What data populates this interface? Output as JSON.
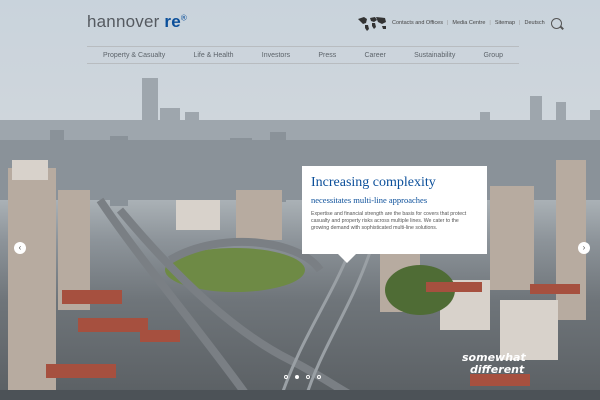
{
  "header": {
    "logo_main": "hannover ",
    "logo_accent": "re",
    "logo_mark": "®",
    "utility_links": [
      "Contacts and Offices",
      "Media Centre",
      "Sitemap",
      "Deutsch"
    ],
    "utility_separator": "|",
    "search_icon": "search-icon",
    "globe_icon": "world-map-icon"
  },
  "nav": {
    "items": [
      "Property & Casualty",
      "Life & Health",
      "Investors",
      "Press",
      "Career",
      "Sustainability",
      "Group"
    ]
  },
  "teaser": {
    "title": "Increasing complexity",
    "subtitle": "necessitates multi-line approaches",
    "body": "Expertise and financial strength are the basis for covers that protect casualty and property risks across multiple lines. We cater to the growing demand with sophisticated multi-line solutions."
  },
  "carousel": {
    "prev_label": "‹",
    "next_label": "›",
    "slide_count": 4,
    "active_slide": 1
  },
  "tagline": {
    "line1": "somewhat",
    "line2": "different"
  },
  "colors": {
    "brand_blue": "#0b4f9a",
    "nav_text": "#5d636a"
  }
}
